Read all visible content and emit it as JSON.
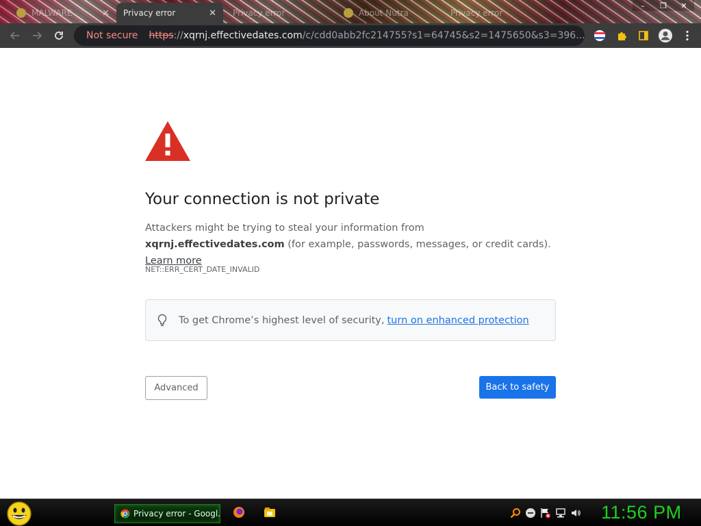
{
  "browser": {
    "tabs": [
      {
        "title": "MALWARE",
        "active": false
      },
      {
        "title": "Privacy error",
        "active": true
      },
      {
        "title": "Privacy error",
        "active": false
      },
      {
        "title": "About Nutra",
        "active": false
      },
      {
        "title": "Privacy error",
        "active": false
      }
    ],
    "window_controls": [
      "–",
      "❐",
      "✕"
    ],
    "omnibox": {
      "security_label": "Not secure",
      "url_scheme": "https",
      "url_sep": "://",
      "url_host": "xqrnj.effectivedates.com",
      "url_path": "/c/cdd0abb2fc214755?s1=64745&s2=1475650&s3=396..."
    }
  },
  "page": {
    "title": "Your connection is not private",
    "desc_prefix": "Attackers might be trying to steal your information from ",
    "desc_host": "xqrnj.effectivedates.com",
    "desc_suffix": " (for example, passwords, messages, or credit cards). ",
    "learn_more": "Learn more",
    "error_code": "NET::ERR_CERT_DATE_INVALID",
    "enhanced_text": "To get Chrome’s highest level of security,",
    "enhanced_link": "turn on enhanced protection",
    "advanced_button": "Advanced",
    "back_button": "Back to safety"
  },
  "taskbar": {
    "active_window": "Privacy error - Googl...",
    "clock": "11:56 PM"
  },
  "colors": {
    "warning_red": "#d93025",
    "primary_blue": "#1a73e8",
    "clock_green": "#20d020"
  }
}
